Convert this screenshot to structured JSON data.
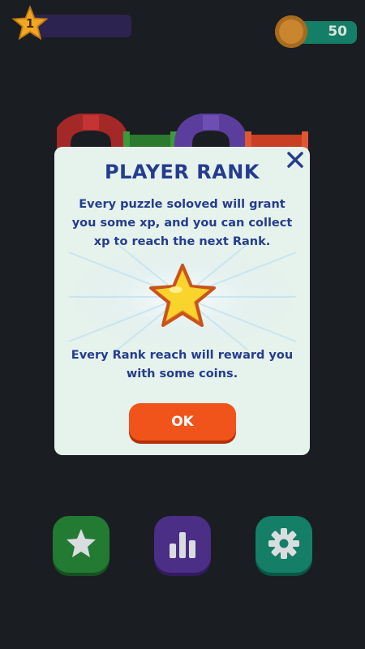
{
  "top_bar": {
    "rank_level": "1",
    "coin_count": "50"
  },
  "modal": {
    "title": "PLAYER RANK",
    "paragraph_1": "Every puzzle soloved will grant you some xp,  and you can collect xp to reach the next Rank.",
    "paragraph_2": "Every Rank reach will reward you with some coins.",
    "ok_label": "OK"
  },
  "bottom_nav": {
    "items": [
      {
        "icon": "star-icon"
      },
      {
        "icon": "bar-chart-icon"
      },
      {
        "icon": "gear-icon"
      }
    ]
  },
  "colors": {
    "background": "#1a1d21",
    "modal_bg": "#e6f2ec",
    "text_blue": "#253c8e",
    "ok_orange": "#f0541a",
    "green_button": "#237a33",
    "purple_button": "#4b2e86",
    "teal_button": "#147f66",
    "star_yellow": "#f6c824"
  }
}
